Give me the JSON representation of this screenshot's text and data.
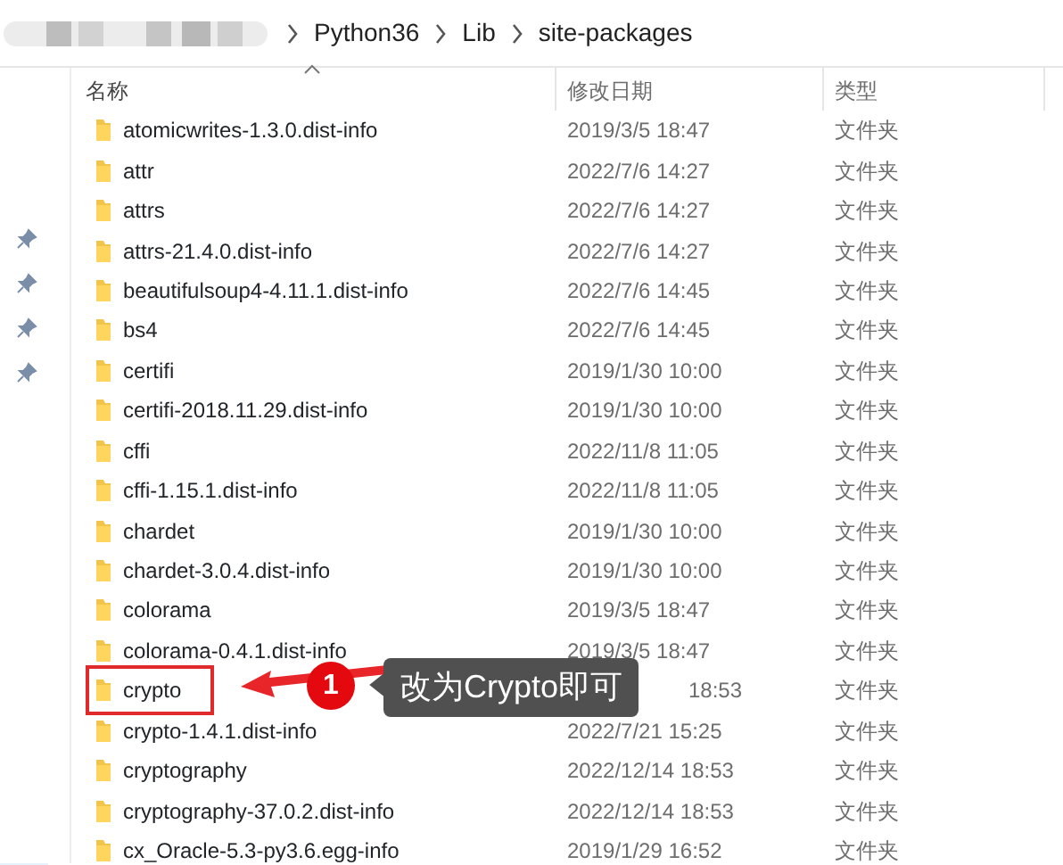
{
  "breadcrumb": [
    {
      "label": "Python36"
    },
    {
      "label": "Lib"
    },
    {
      "label": "site-packages"
    }
  ],
  "columns": [
    {
      "label": "名称",
      "sorted": true
    },
    {
      "label": "修改日期",
      "sorted": false
    },
    {
      "label": "类型",
      "sorted": false
    }
  ],
  "rows": [
    {
      "name": "atomicwrites-1.3.0.dist-info",
      "date": "2019/3/5 18:47",
      "type": "文件夹",
      "highlighted": false
    },
    {
      "name": "attr",
      "date": "2022/7/6 14:27",
      "type": "文件夹",
      "highlighted": false
    },
    {
      "name": "attrs",
      "date": "2022/7/6 14:27",
      "type": "文件夹",
      "highlighted": false
    },
    {
      "name": "attrs-21.4.0.dist-info",
      "date": "2022/7/6 14:27",
      "type": "文件夹",
      "highlighted": false
    },
    {
      "name": "beautifulsoup4-4.11.1.dist-info",
      "date": "2022/7/6 14:45",
      "type": "文件夹",
      "highlighted": false
    },
    {
      "name": "bs4",
      "date": "2022/7/6 14:45",
      "type": "文件夹",
      "highlighted": false
    },
    {
      "name": "certifi",
      "date": "2019/1/30 10:00",
      "type": "文件夹",
      "highlighted": false
    },
    {
      "name": "certifi-2018.11.29.dist-info",
      "date": "2019/1/30 10:00",
      "type": "文件夹",
      "highlighted": false
    },
    {
      "name": "cffi",
      "date": "2022/11/8 11:05",
      "type": "文件夹",
      "highlighted": false
    },
    {
      "name": "cffi-1.15.1.dist-info",
      "date": "2022/11/8 11:05",
      "type": "文件夹",
      "highlighted": false
    },
    {
      "name": "chardet",
      "date": "2019/1/30 10:00",
      "type": "文件夹",
      "highlighted": false
    },
    {
      "name": "chardet-3.0.4.dist-info",
      "date": "2019/1/30 10:00",
      "type": "文件夹",
      "highlighted": false
    },
    {
      "name": "colorama",
      "date": "2019/3/5 18:47",
      "type": "文件夹",
      "highlighted": false
    },
    {
      "name": "colorama-0.4.1.dist-info",
      "date": "2019/3/5 18:47",
      "type": "文件夹",
      "highlighted": false
    },
    {
      "name": "crypto",
      "date": "18:53",
      "date_cut": true,
      "type": "文件夹",
      "highlighted": true
    },
    {
      "name": "crypto-1.4.1.dist-info",
      "date": "2022/7/21 15:25",
      "type": "文件夹",
      "highlighted": false
    },
    {
      "name": "cryptography",
      "date": "2022/12/14 18:53",
      "type": "文件夹",
      "highlighted": false
    },
    {
      "name": "cryptography-37.0.2.dist-info",
      "date": "2022/12/14 18:53",
      "type": "文件夹",
      "highlighted": false
    },
    {
      "name": "cx_Oracle-5.3-py3.6.egg-info",
      "date": "2019/1/29 16:52",
      "type": "文件夹",
      "highlighted": false
    }
  ],
  "callout": {
    "number": "1",
    "text": "改为Crypto即可"
  }
}
